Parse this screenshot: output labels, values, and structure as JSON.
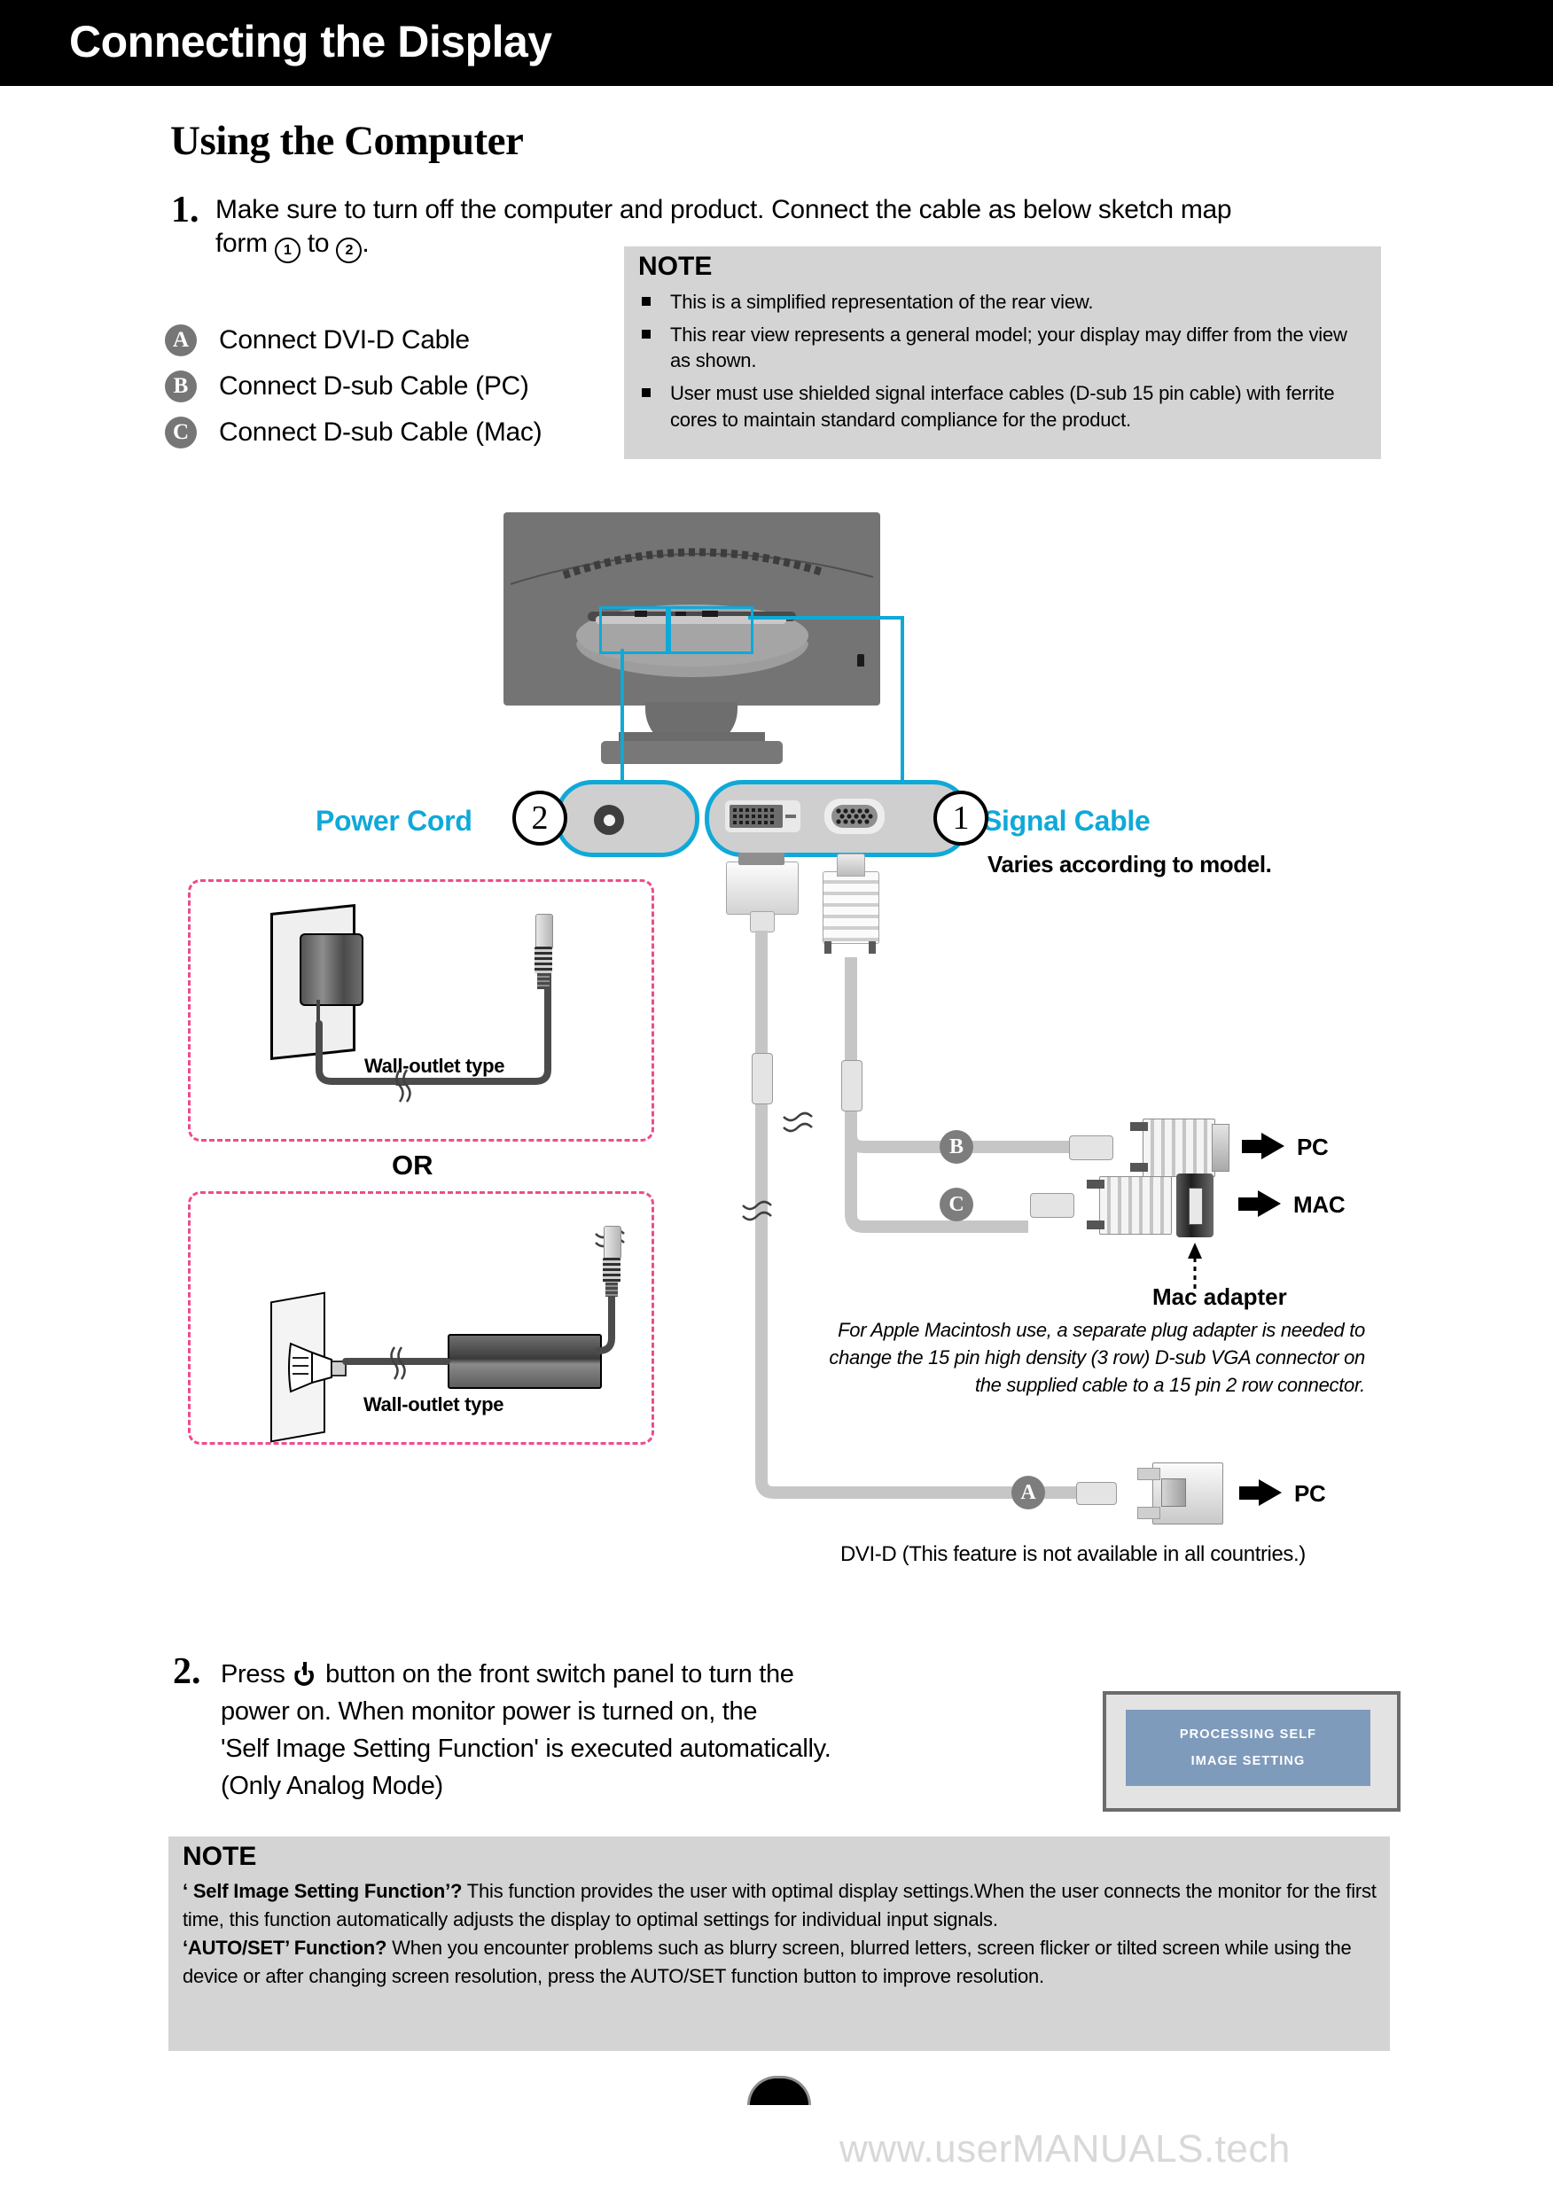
{
  "header": {
    "title": "Connecting the Display"
  },
  "section": {
    "title": "Using the Computer"
  },
  "step1": {
    "number": "1.",
    "text_a": "Make sure to turn off the computer and  product. Connect the cable as below sketch map",
    "text_b_pre": "form ",
    "circle1": "1",
    "text_b_mid": " to ",
    "circle2": "2",
    "text_b_post": "."
  },
  "legend": [
    {
      "badge": "A",
      "label": "Connect DVI-D Cable"
    },
    {
      "badge": "B",
      "label": "Connect D-sub Cable (PC)"
    },
    {
      "badge": "C",
      "label": "Connect D-sub Cable (Mac)"
    }
  ],
  "note_top": {
    "heading": "NOTE",
    "items": [
      "This is a simplified representation of the rear view.",
      "This rear view represents a general model; your display may differ from the view as shown.",
      "User must use shielded signal interface cables (D-sub 15 pin cable) with ferrite cores to maintain standard compliance for the product."
    ]
  },
  "diagram": {
    "power_cord_label": "Power Cord",
    "power_cord_number": "2",
    "signal_cable_label": "Signal Cable",
    "signal_cable_number": "1",
    "varies_note": "Varies according to model.",
    "wall_outlet_label_1": "Wall-outlet type",
    "wall_outlet_label_2": "Wall-outlet type",
    "or_label": "OR",
    "badge_b": "B",
    "badge_c": "C",
    "badge_a": "A",
    "dest_pc_1": "PC",
    "dest_mac": "MAC",
    "dest_pc_2": "PC",
    "mac_adapter_title": "Mac adapter",
    "mac_adapter_note": "For Apple Macintosh use, a  separate plug adapter is needed to change the 15 pin high density (3 row) D-sub VGA connector on the supplied cable to a 15 pin  2 row connector.",
    "dvid_note": "DVI-D (This feature is not available in all countries.)"
  },
  "step2": {
    "number": "2.",
    "line1_pre": "Press ",
    "line1_post": " button on the front switch panel to turn the",
    "line2": "power on. When monitor power is turned on, the",
    "line3": "'Self Image Setting Function' is executed automatically.",
    "line4": "(Only Analog Mode)"
  },
  "osd": {
    "line1": "PROCESSING SELF",
    "line2": "IMAGE SETTING"
  },
  "note_bottom": {
    "heading": "NOTE",
    "p1_bold": "‘ Self Image Setting Function’?",
    "p1_text": " This function provides the user with optimal display settings.When the user connects the monitor for the first time, this function automatically adjusts the display to optimal settings for individual input signals.",
    "p2_bold": "‘AUTO/SET’ Function?",
    "p2_text": " When you encounter problems such as blurry screen, blurred letters, screen flicker or tilted screen while using the device or after changing screen resolution, press the AUTO/SET function button to improve resolution."
  },
  "footer": {
    "watermark": "www.userMANUALS.tech"
  },
  "colors": {
    "accent_cyan": "#0fa9d8",
    "accent_pink": "#ee4c8c",
    "note_bg": "#d4d4d4",
    "badge_gray": "#767676",
    "osd_blue": "#7e9bbc"
  }
}
